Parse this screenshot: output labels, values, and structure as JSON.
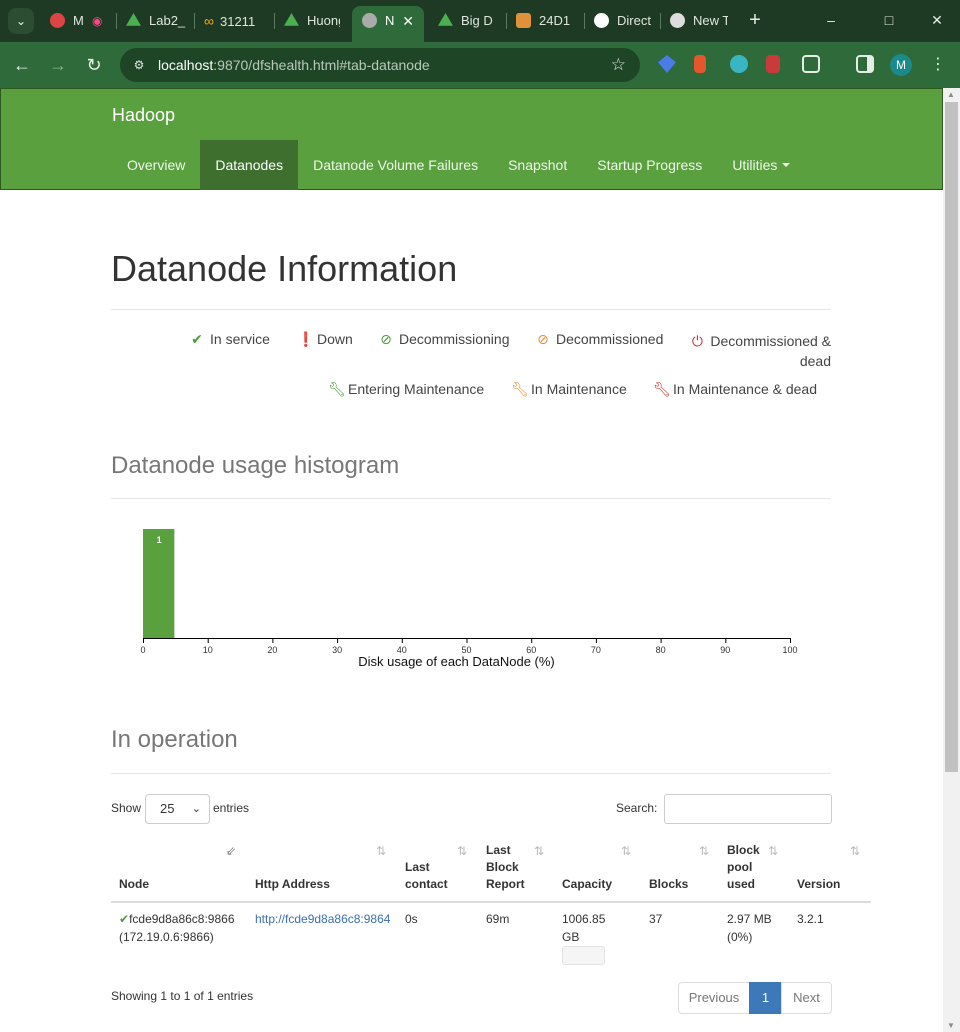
{
  "browser": {
    "tabs": [
      {
        "label": "M",
        "favicon_color": "#d44"
      },
      {
        "label": "Lab2_",
        "favicon_color": "#4caf50"
      },
      {
        "label": "31211",
        "favicon_color": "#f5a623"
      },
      {
        "label": "Huong",
        "favicon_color": "#4caf50"
      },
      {
        "label": "N",
        "favicon_color": "#999"
      },
      {
        "label": "Big D",
        "favicon_color": "#4caf50"
      },
      {
        "label": "24D1",
        "favicon_color": "#e0913a"
      },
      {
        "label": "Direct",
        "favicon_color": "#fff"
      },
      {
        "label": "New T",
        "favicon_color": "#ddd"
      }
    ],
    "url_host": "localhost",
    "url_rest": ":9870/dfshealth.html#tab-datanode",
    "profile_initial": "M"
  },
  "navbar": {
    "brand": "Hadoop",
    "links": [
      "Overview",
      "Datanodes",
      "Datanode Volume Failures",
      "Snapshot",
      "Startup Progress",
      "Utilities"
    ]
  },
  "page": {
    "title": "Datanode Information",
    "legend": {
      "in_service": "In service",
      "down": "Down",
      "decommissioning": "Decommissioning",
      "decommissioned": "Decommissioned",
      "decommissioned_dead_1": "Decommissioned &",
      "decommissioned_dead_2": "dead",
      "entering_maintenance": "Entering Maintenance",
      "in_maintenance": "In Maintenance",
      "in_maintenance_dead": "In Maintenance & dead"
    },
    "histogram_heading": "Datanode usage histogram",
    "operation_heading": "In operation"
  },
  "chart_data": {
    "type": "bar",
    "categories": [
      "0-5"
    ],
    "values": [
      1
    ],
    "data_labels": [
      "1"
    ],
    "xlabel": "Disk usage of each DataNode (%)",
    "xlim": [
      0,
      100
    ],
    "xticks": [
      0,
      10,
      20,
      30,
      40,
      50,
      60,
      70,
      80,
      90,
      100
    ],
    "bar_color": "#5aa03f"
  },
  "table": {
    "show_label": "Show",
    "page_size": "25",
    "entries_label": "entries",
    "search_label": "Search:",
    "headers": {
      "node": "Node",
      "http": "Http Address",
      "last_contact_1": "Last",
      "last_contact_2": "contact",
      "last_block_1": "Last",
      "last_block_2": "Block",
      "last_block_3": "Report",
      "capacity": "Capacity",
      "blocks": "Blocks",
      "pool_1": "Block",
      "pool_2": "pool",
      "pool_3": "used",
      "version": "Version"
    },
    "row": {
      "node_name": "fcde9d8a86c8:9866",
      "node_ip": "(172.19.0.6:9866)",
      "http_address": "http://fcde9d8a86c8:9864",
      "last_contact": "0s",
      "last_block_report": "69m",
      "capacity_1": "1006.85",
      "capacity_2": "GB",
      "blocks": "37",
      "pool_used_1": "2.97 MB",
      "pool_used_2": "(0%)",
      "version": "3.2.1"
    },
    "info": "Showing 1 to 1 of 1 entries",
    "pagination": {
      "previous": "Previous",
      "current": "1",
      "next": "Next"
    }
  }
}
